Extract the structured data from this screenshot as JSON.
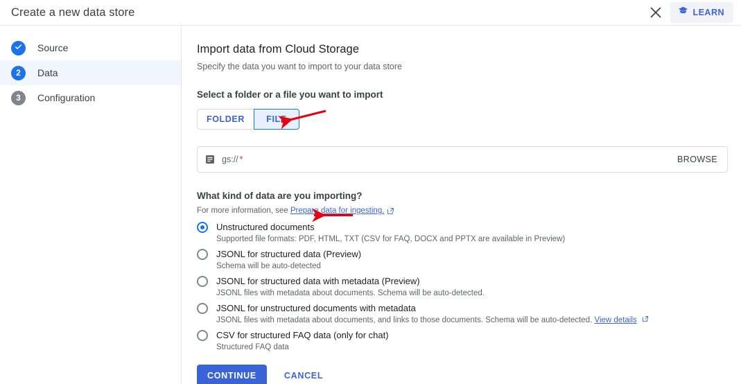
{
  "window": {
    "title": "Create a new data store",
    "close_icon": "close-icon",
    "learn_label": "LEARN",
    "learn_icon": "graduation-cap-icon"
  },
  "colors": {
    "accent_blue": "#1a73e8",
    "button_blue": "#3a63d8",
    "selected_tab_fill": "#e8f0fe",
    "active_step_row": "#f1f5fd",
    "inactive_step_gray": "#80868b",
    "required_red": "#d93025",
    "annotation_red": "#e8000d",
    "muted_text": "#5f6368",
    "primary_text": "#202124"
  },
  "sidebar": {
    "items": [
      {
        "label": "Source",
        "marker": "check",
        "state": "done"
      },
      {
        "label": "Data",
        "marker": "2",
        "state": "current"
      },
      {
        "label": "Configuration",
        "marker": "3",
        "state": "todo"
      }
    ]
  },
  "main": {
    "page_title": "Import data from Cloud Storage",
    "page_subtitle": "Specify the data you want to import to your data store",
    "select_section_title": "Select a folder or a file you want to import",
    "source_type_tabs": [
      {
        "label": "FOLDER",
        "selected": false
      },
      {
        "label": "FILE",
        "selected": true
      }
    ],
    "path_field": {
      "icon": "cloud-storage-icon",
      "prefix": "gs://",
      "required_marker": "*",
      "value": "",
      "placeholder": "",
      "browse_label": "BROWSE"
    },
    "kind_section": {
      "title": "What kind of data are you importing?",
      "help_prefix": "For more information, see",
      "help_link": "Prepare data for ingesting.",
      "help_link_icon": "external-link-icon"
    },
    "data_kind_options": [
      {
        "label": "Unstructured documents",
        "description": "Supported file formats: PDF, HTML, TXT (CSV for FAQ, DOCX and PPTX are available in Preview)",
        "selected": true,
        "link": "",
        "link_icon": ""
      },
      {
        "label": "JSONL for structured data (Preview)",
        "description": "Schema will be auto-detected",
        "selected": false,
        "link": "",
        "link_icon": ""
      },
      {
        "label": "JSONL for structured data with metadata (Preview)",
        "description": "JSONL files with metadata about documents. Schema will be auto-detected.",
        "selected": false,
        "link": "",
        "link_icon": ""
      },
      {
        "label": "JSONL for unstructured documents with metadata",
        "description": "JSONL files with metadata about documents, and links to those documents. Schema will be auto-detected.",
        "selected": false,
        "link": "View details",
        "link_icon": "external-link-icon"
      },
      {
        "label": "CSV for structured FAQ data (only for chat)",
        "description": "Structured FAQ data",
        "selected": false,
        "link": "",
        "link_icon": ""
      }
    ],
    "actions": {
      "continue_label": "CONTINUE",
      "cancel_label": "CANCEL"
    }
  },
  "annotations": [
    {
      "name": "arrow-to-file-tab",
      "target": "FILE"
    },
    {
      "name": "arrow-to-unstructured-documents",
      "target": "Unstructured documents"
    }
  ]
}
